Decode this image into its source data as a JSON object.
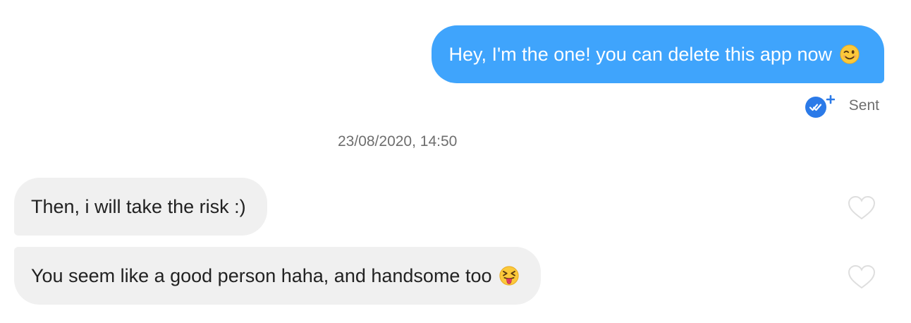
{
  "messages": [
    {
      "direction": "outgoing",
      "text": "Hey, I'm the one! you can delete this app now",
      "emoji": "winking-face"
    },
    {
      "direction": "incoming",
      "text": "Then, i will take the risk :)"
    },
    {
      "direction": "incoming",
      "text": "You seem like a good person haha, and handsome too",
      "emoji": "squinting-face-with-tongue"
    }
  ],
  "receipt": {
    "status_label": "Sent",
    "icon": "double-check-plus-icon"
  },
  "timestamp": "23/08/2020, 14:50",
  "icons": {
    "like": "heart-outline-icon"
  },
  "colors": {
    "outgoing_bubble": "#3fa4fc",
    "incoming_bubble": "#f0f0f0",
    "receipt_badge": "#2b7ae8",
    "muted_text": "#6e6e6e"
  }
}
